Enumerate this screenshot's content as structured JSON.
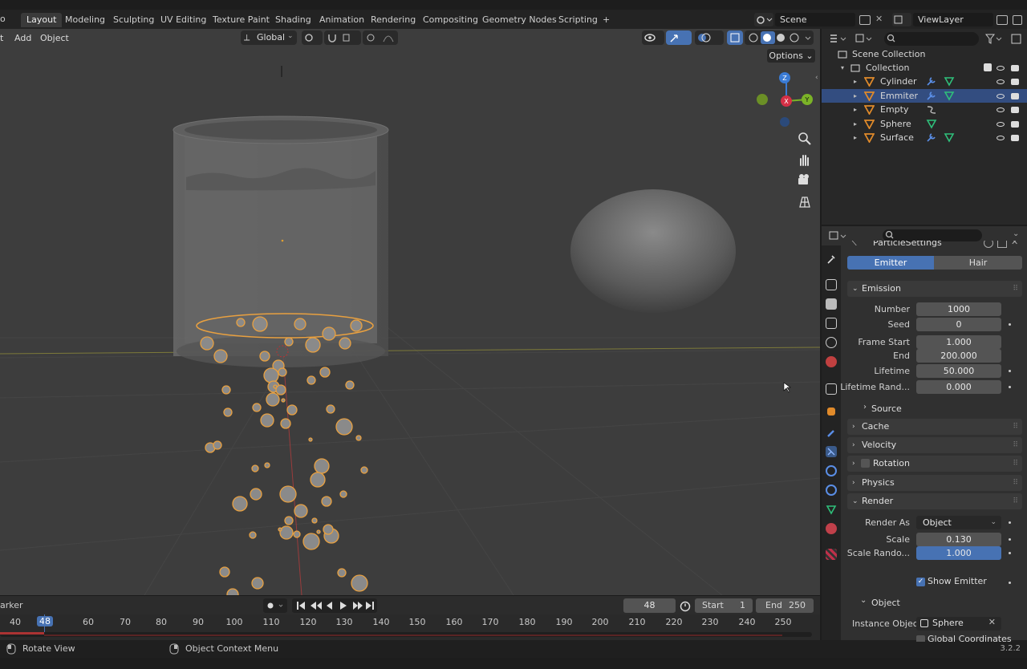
{
  "workspaces": [
    "Layout",
    "Modeling",
    "Sculpting",
    "UV Editing",
    "Texture Paint",
    "Shading",
    "Animation",
    "Rendering",
    "Compositing",
    "Geometry Nodes",
    "Scripting",
    "+"
  ],
  "scene_label": "Scene",
  "viewlayer_label": "ViewLayer",
  "viewport": {
    "menu": [
      "Add",
      "Object"
    ],
    "transform_orientation": "Global",
    "options_label": "Options",
    "gizmo": {
      "z": "Z",
      "x": "X",
      "y": "Y"
    }
  },
  "outliner": {
    "root": "Scene Collection",
    "collection": "Collection",
    "items": [
      {
        "name": "Cylinder",
        "selected": false
      },
      {
        "name": "Emmiter",
        "selected": true
      },
      {
        "name": "Empty",
        "selected": false
      },
      {
        "name": "Sphere",
        "selected": false
      },
      {
        "name": "Surface",
        "selected": false
      }
    ]
  },
  "properties": {
    "datablock": "ParticleSettings",
    "type_tabs": [
      "Emitter",
      "Hair"
    ],
    "emission": {
      "title": "Emission",
      "number_label": "Number",
      "number": "1000",
      "seed_label": "Seed",
      "seed": "0",
      "frame_start_label": "Frame Start",
      "frame_start": "1.000",
      "end_label": "End",
      "end": "200.000",
      "lifetime_label": "Lifetime",
      "lifetime": "50.000",
      "lifetime_random_label": "Lifetime Rand...",
      "lifetime_random": "0.000",
      "source_label": "Source"
    },
    "panels": [
      "Cache",
      "Velocity",
      "Rotation",
      "Physics"
    ],
    "render": {
      "title": "Render",
      "render_as_label": "Render As",
      "render_as": "Object",
      "scale_label": "Scale",
      "scale": "0.130",
      "scale_random_label": "Scale Rando...",
      "scale_random": "1.000",
      "show_emitter_label": "Show Emitter",
      "object_panel": "Object",
      "instance_object_label": "Instance Object",
      "instance_object": "Sphere",
      "global_coords_label": "Global Coordinates"
    }
  },
  "timeline": {
    "marker_label": "arker",
    "current_frame": "48",
    "start_label": "Start",
    "start": "1",
    "end_label": "End",
    "end": "250",
    "ticks": [
      "40",
      "48",
      "60",
      "70",
      "80",
      "90",
      "100",
      "110",
      "120",
      "130",
      "140",
      "150",
      "160",
      "170",
      "180",
      "190",
      "200",
      "210",
      "220",
      "230",
      "240",
      "250"
    ]
  },
  "status": {
    "left": "Rotate View",
    "middle": "Object Context Menu",
    "version": "3.2.2"
  },
  "colors": {
    "selection_blue": "#334d80",
    "accent_blue": "#4772b3",
    "particle_orange": "#e8a040"
  }
}
